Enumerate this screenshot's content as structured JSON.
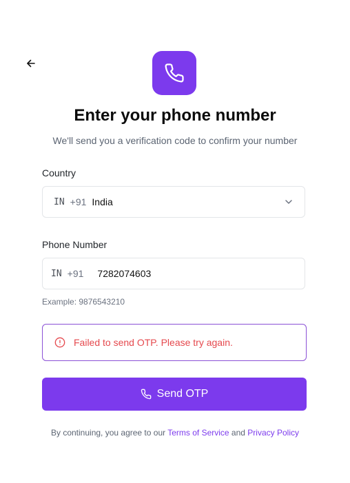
{
  "header": {
    "back_icon": "arrow-left-icon",
    "logo_icon": "phone-icon",
    "title": "Enter your phone number",
    "subtitle": "We'll send you a verification code to confirm your number"
  },
  "country": {
    "label": "Country",
    "iso": "IN",
    "dial_code": "+91",
    "name": "India",
    "dropdown_icon": "chevron-down-icon"
  },
  "phone": {
    "label": "Phone Number",
    "iso": "IN",
    "dial_code": "+91",
    "value": "7282074603",
    "hint": "Example: 9876543210"
  },
  "error": {
    "icon": "alert-circle-icon",
    "message": "Failed to send OTP. Please try again."
  },
  "send_button": {
    "icon": "phone-icon",
    "label": "Send OTP"
  },
  "terms": {
    "prefix": "By continuing, you agree to our ",
    "tos_label": "Terms of Service",
    "conjunction": " and ",
    "privacy_label": "Privacy Policy"
  },
  "colors": {
    "accent": "#7c3aed",
    "error": "#e5484d"
  }
}
